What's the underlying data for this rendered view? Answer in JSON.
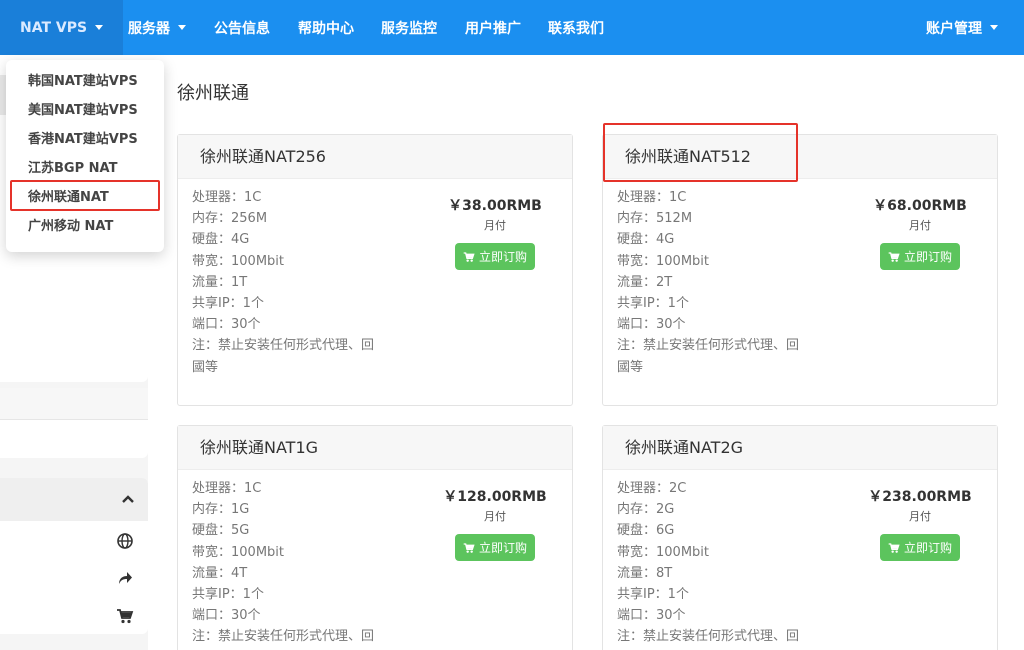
{
  "nav": {
    "brand": "NAT VPS",
    "servers": "服务器",
    "announcements": "公告信息",
    "help": "帮助中心",
    "monitor": "服务监控",
    "referral": "用户推广",
    "contact": "联系我们",
    "account": "账户管理"
  },
  "dropdown": {
    "items": [
      "韩国NAT建站VPS",
      "美国NAT建站VPS",
      "香港NAT建站VPS",
      "江苏BGP NAT",
      "徐州联通NAT",
      "广州移动 NAT"
    ],
    "selected": "徐州联通NAT"
  },
  "page": {
    "title": "徐州联通"
  },
  "products": [
    {
      "name": "徐州联通NAT256",
      "specs": [
        "处理器：1C",
        "内存：256M",
        "硬盘：4G",
        "带宽：100Mbit",
        "流量：1T",
        "共享IP：1个",
        "端口：30个",
        "注：禁止安装任何形式代理、回",
        "國等"
      ],
      "price": "￥38.00RMB",
      "cycle": "月付",
      "button": "立即订购"
    },
    {
      "name": "徐州联通NAT512",
      "specs": [
        "处理器：1C",
        "内存：512M",
        "硬盘：4G",
        "带宽：100Mbit",
        "流量：2T",
        "共享IP：1个",
        "端口：30个",
        "注：禁止安装任何形式代理、回",
        "國等"
      ],
      "price": "￥68.00RMB",
      "cycle": "月付",
      "button": "立即订购"
    },
    {
      "name": "徐州联通NAT1G",
      "specs": [
        "处理器：1C",
        "内存：1G",
        "硬盘：5G",
        "带宽：100Mbit",
        "流量：4T",
        "共享IP：1个",
        "端口：30个",
        "注：禁止安装任何形式代理、回"
      ],
      "price": "￥128.00RMB",
      "cycle": "月付",
      "button": "立即订购"
    },
    {
      "name": "徐州联通NAT2G",
      "specs": [
        "处理器：2C",
        "内存：2G",
        "硬盘：6G",
        "带宽：100Mbit",
        "流量：8T",
        "共享IP：1个",
        "端口：30个",
        "注：禁止安装任何形式代理、回"
      ],
      "price": "￥238.00RMB",
      "cycle": "月付",
      "button": "立即订购"
    }
  ],
  "sidebar": {
    "icons": [
      "globe-icon",
      "share-icon",
      "cart-icon"
    ]
  },
  "colors": {
    "nav_bg": "#1b8ff0",
    "order_button": "#5cc45d",
    "highlight": "#e5332a"
  }
}
